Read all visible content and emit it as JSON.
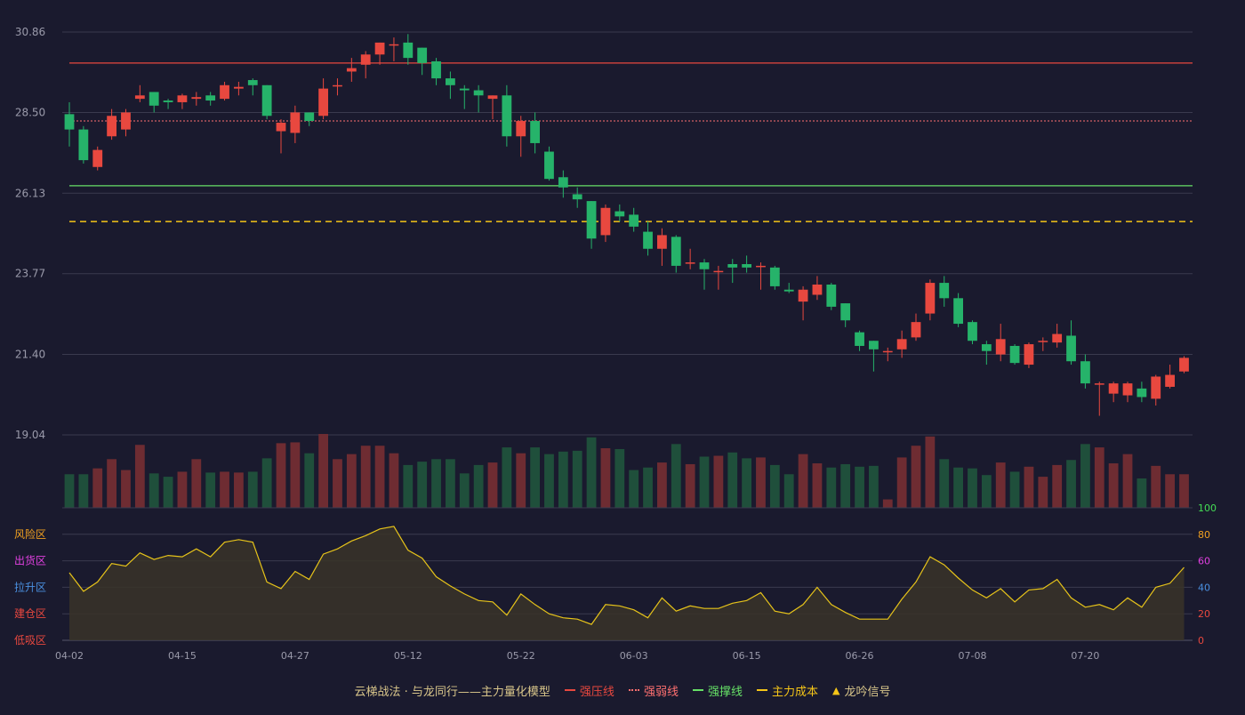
{
  "colors": {
    "background": "#1a1a2e",
    "up": "#e8483f",
    "down": "#26b36a",
    "vol_up": "#6e2c32",
    "vol_down": "#1f4f3b",
    "grid": "#3a3a4e",
    "axis_text": "#9a9aaa",
    "strong_pressure": "#e8483f",
    "strong_weak": "#ff7070",
    "strong_support": "#66e066",
    "main_cost": "#f5c518",
    "indicator_line": "#e6c31a"
  },
  "chart_data": {
    "type": "candlestick",
    "price_axis": {
      "ticks": [
        "30.86",
        "28.50",
        "26.13",
        "23.77",
        "21.40",
        "19.04"
      ],
      "range": [
        19.04,
        30.86
      ]
    },
    "date_labels": [
      {
        "i": 0,
        "label": "04-02"
      },
      {
        "i": 8,
        "label": "04-15"
      },
      {
        "i": 16,
        "label": "04-27"
      },
      {
        "i": 24,
        "label": "05-12"
      },
      {
        "i": 32,
        "label": "05-22"
      },
      {
        "i": 40,
        "label": "06-03"
      },
      {
        "i": 48,
        "label": "06-15"
      },
      {
        "i": 56,
        "label": "06-26"
      },
      {
        "i": 64,
        "label": "07-08"
      },
      {
        "i": 72,
        "label": "07-20"
      }
    ],
    "candles": [
      [
        28.45,
        28.0,
        28.8,
        27.5
      ],
      [
        28.0,
        27.1,
        28.1,
        27.0
      ],
      [
        26.9,
        27.4,
        27.5,
        26.8
      ],
      [
        27.8,
        28.4,
        28.6,
        27.7
      ],
      [
        28.0,
        28.5,
        28.6,
        27.8
      ],
      [
        28.9,
        29.0,
        29.3,
        28.8
      ],
      [
        29.1,
        28.7,
        29.1,
        28.5
      ],
      [
        28.85,
        28.8,
        28.9,
        28.6
      ],
      [
        28.8,
        29.0,
        29.05,
        28.6
      ],
      [
        28.9,
        28.95,
        29.1,
        28.7
      ],
      [
        29.0,
        28.85,
        29.1,
        28.7
      ],
      [
        28.9,
        29.3,
        29.4,
        28.85
      ],
      [
        29.2,
        29.25,
        29.4,
        29.0
      ],
      [
        29.45,
        29.3,
        29.5,
        29.0
      ],
      [
        29.3,
        28.4,
        29.3,
        28.3
      ],
      [
        27.95,
        28.2,
        28.3,
        27.3
      ],
      [
        27.9,
        28.5,
        28.7,
        27.6
      ],
      [
        28.5,
        28.25,
        28.5,
        28.1
      ],
      [
        28.4,
        29.2,
        29.5,
        28.3
      ],
      [
        29.3,
        29.3,
        29.5,
        29.0
      ],
      [
        29.7,
        29.8,
        30.1,
        29.4
      ],
      [
        29.9,
        30.2,
        30.3,
        29.5
      ],
      [
        30.2,
        30.55,
        30.55,
        29.9
      ],
      [
        30.5,
        30.5,
        30.7,
        30.0
      ],
      [
        30.55,
        30.1,
        30.8,
        29.9
      ],
      [
        30.4,
        29.95,
        30.4,
        29.6
      ],
      [
        30.0,
        29.5,
        30.1,
        29.3
      ],
      [
        29.5,
        29.3,
        29.7,
        28.9
      ],
      [
        29.2,
        29.15,
        29.3,
        28.6
      ],
      [
        29.15,
        29.0,
        29.3,
        28.5
      ],
      [
        28.9,
        29.0,
        29.0,
        28.3
      ],
      [
        29.0,
        27.8,
        29.3,
        27.5
      ],
      [
        27.8,
        28.25,
        28.4,
        27.2
      ],
      [
        28.25,
        27.6,
        28.5,
        27.3
      ],
      [
        27.35,
        26.55,
        27.5,
        26.5
      ],
      [
        26.6,
        26.3,
        26.8,
        26.0
      ],
      [
        26.1,
        25.95,
        26.3,
        25.7
      ],
      [
        25.9,
        24.8,
        25.9,
        24.5
      ],
      [
        24.9,
        25.7,
        25.8,
        24.7
      ],
      [
        25.6,
        25.45,
        25.8,
        25.3
      ],
      [
        25.5,
        25.15,
        25.7,
        25.0
      ],
      [
        25.0,
        24.5,
        25.3,
        24.3
      ],
      [
        24.5,
        24.9,
        25.1,
        24.0
      ],
      [
        24.85,
        24.0,
        24.9,
        23.8
      ],
      [
        24.1,
        24.1,
        24.5,
        23.9
      ],
      [
        24.1,
        23.9,
        24.2,
        23.3
      ],
      [
        23.85,
        23.85,
        24.0,
        23.3
      ],
      [
        24.05,
        23.95,
        24.2,
        23.5
      ],
      [
        24.05,
        23.95,
        24.3,
        23.8
      ],
      [
        24.0,
        24.0,
        24.1,
        23.3
      ],
      [
        23.95,
        23.4,
        24.0,
        23.3
      ],
      [
        23.3,
        23.25,
        23.5,
        23.2
      ],
      [
        22.95,
        23.3,
        23.4,
        22.4
      ],
      [
        23.15,
        23.45,
        23.7,
        23.0
      ],
      [
        23.45,
        22.8,
        23.5,
        22.7
      ],
      [
        22.9,
        22.4,
        22.9,
        22.2
      ],
      [
        22.05,
        21.65,
        22.1,
        21.5
      ],
      [
        21.8,
        21.55,
        21.8,
        20.9
      ],
      [
        21.5,
        21.5,
        21.6,
        21.2
      ],
      [
        21.55,
        21.85,
        22.1,
        21.3
      ],
      [
        21.9,
        22.35,
        22.6,
        21.8
      ],
      [
        22.6,
        23.5,
        23.6,
        22.4
      ],
      [
        23.5,
        23.05,
        23.7,
        22.8
      ],
      [
        23.05,
        22.3,
        23.2,
        22.2
      ],
      [
        22.35,
        21.8,
        22.4,
        21.7
      ],
      [
        21.7,
        21.5,
        21.8,
        21.1
      ],
      [
        21.4,
        21.85,
        22.3,
        21.2
      ],
      [
        21.65,
        21.15,
        21.7,
        21.1
      ],
      [
        21.1,
        21.7,
        21.75,
        21.0
      ],
      [
        21.8,
        21.8,
        21.9,
        21.5
      ],
      [
        21.75,
        22.0,
        22.3,
        21.6
      ],
      [
        21.95,
        21.2,
        22.4,
        21.1
      ],
      [
        21.2,
        20.55,
        21.4,
        20.4
      ],
      [
        20.55,
        20.55,
        20.6,
        19.6
      ],
      [
        20.25,
        20.55,
        20.6,
        20.0
      ],
      [
        20.2,
        20.55,
        20.6,
        20.0
      ],
      [
        20.4,
        20.15,
        20.6,
        20.0
      ],
      [
        20.1,
        20.75,
        20.8,
        19.9
      ],
      [
        20.45,
        20.8,
        21.1,
        20.4
      ],
      [
        20.9,
        21.3,
        21.35,
        20.85
      ]
    ],
    "volume": [
      40,
      40,
      47,
      58,
      45,
      75,
      41,
      37,
      43,
      58,
      42,
      43,
      42,
      43,
      59,
      77,
      78,
      65,
      88,
      58,
      64,
      74,
      74,
      65,
      51,
      55,
      58,
      58,
      41,
      51,
      54,
      72,
      65,
      72,
      64,
      67,
      68,
      84,
      71,
      70,
      45,
      48,
      54,
      76,
      52,
      61,
      62,
      66,
      59,
      60,
      51,
      40,
      64,
      53,
      48,
      52,
      49,
      50,
      10,
      60,
      74,
      85,
      58,
      48,
      47,
      39,
      54,
      43,
      49,
      37,
      51,
      57,
      76,
      72,
      53,
      64,
      35,
      50,
      40,
      40
    ],
    "volume_max": 88,
    "indicator": {
      "ylim": [
        0,
        100
      ],
      "ticks_right": [
        "100",
        "80",
        "60",
        "40",
        "20",
        "0"
      ],
      "zones_left": [
        "风险区",
        "出货区",
        "拉升区",
        "建仓区",
        "低吸区"
      ],
      "values": [
        51,
        37,
        44,
        58,
        56,
        66,
        61,
        64,
        63,
        69,
        63,
        74,
        76,
        74,
        44,
        39,
        52,
        46,
        65,
        69,
        75,
        79,
        84,
        86,
        68,
        62,
        48,
        41,
        35,
        30,
        29,
        19,
        35,
        27,
        20,
        17,
        16,
        12,
        27,
        26,
        23,
        17,
        32,
        22,
        26,
        24,
        24,
        28,
        30,
        36,
        22,
        20,
        27,
        40,
        27,
        21,
        16,
        16,
        16,
        31,
        44,
        63,
        57,
        47,
        38,
        32,
        39,
        29,
        38,
        39,
        46,
        32,
        25,
        27,
        23,
        32,
        25,
        40,
        43,
        55
      ]
    },
    "lines": {
      "strong_pressure": 29.95,
      "strong_weak": 28.25,
      "strong_support": 26.35,
      "main_cost": 25.3
    }
  },
  "legend": {
    "title": "云梯战法 · 与龙同行——主力量化模型",
    "items": [
      {
        "label": "强压线",
        "color": "#e8483f",
        "style": "solid"
      },
      {
        "label": "强弱线",
        "color": "#ff7070",
        "style": "dotted"
      },
      {
        "label": "强撑线",
        "color": "#66e066",
        "style": "solid"
      },
      {
        "label": "主力成本",
        "color": "#f5c518",
        "style": "dashed"
      },
      {
        "label": "龙吟信号",
        "color": "#f5c518",
        "style": "triangle"
      }
    ]
  }
}
